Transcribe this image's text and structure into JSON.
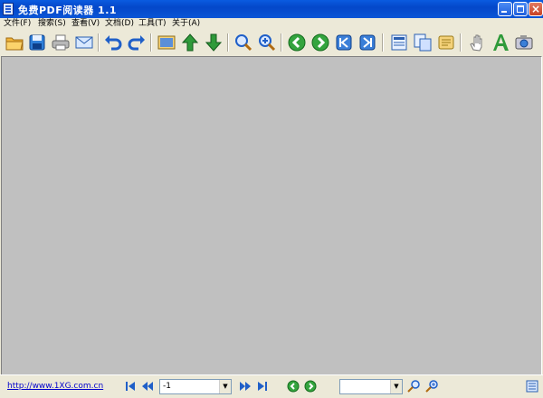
{
  "window": {
    "title": "免费PDF阅读器 1.1"
  },
  "menu": [
    "文件(F)",
    "搜索(S)",
    "查看(V)",
    "文档(D)",
    "工具(T)",
    "关于(A)"
  ],
  "toolbar": {
    "buttons": [
      "open-folder-icon",
      "save-icon",
      "print-icon",
      "email-icon",
      "undo-icon",
      "redo-icon",
      "page-view-icon",
      "arrow-up-icon",
      "arrow-down-icon",
      "zoom-out-icon",
      "zoom-in-icon",
      "back-icon",
      "forward-icon",
      "first-page-icon",
      "last-page-icon",
      "single-page-icon",
      "continuous-pages-icon",
      "bookmark-scroll-icon",
      "hand-tool-icon",
      "text-select-icon",
      "snapshot-icon"
    ]
  },
  "status": {
    "link": "http://www.1XG.com.cn",
    "page_value": "-1",
    "zoom_value": ""
  }
}
